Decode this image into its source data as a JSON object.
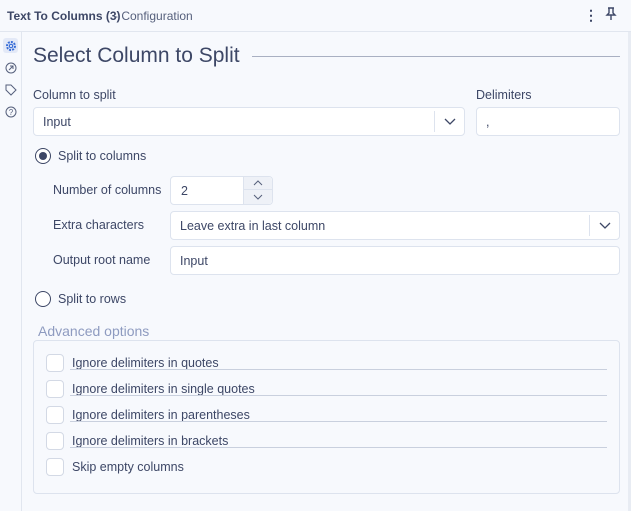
{
  "header": {
    "title": "Text To Columns (3)",
    "subtitle": "- Configuration"
  },
  "rail": {
    "icons": [
      "gear-icon",
      "output-icon",
      "tag-icon",
      "help-icon"
    ]
  },
  "main": {
    "title": "Select Column to Split",
    "column_to_split": {
      "label": "Column to split",
      "value": "Input"
    },
    "delimiters": {
      "label": "Delimiters",
      "value": ","
    },
    "split_columns": {
      "label": "Split to columns",
      "selected": true
    },
    "num_columns": {
      "label": "Number of columns",
      "value": "2"
    },
    "extra_chars": {
      "label": "Extra characters",
      "value": "Leave extra in last column"
    },
    "output_root": {
      "label": "Output root name",
      "value": "Input"
    },
    "split_rows": {
      "label": "Split to rows",
      "selected": false
    },
    "advanced": {
      "label": "Advanced options",
      "options": [
        {
          "label": "Ignore delimiters in quotes",
          "checked": false
        },
        {
          "label": "Ignore delimiters in single quotes",
          "checked": false
        },
        {
          "label": "Ignore delimiters in parentheses",
          "checked": false
        },
        {
          "label": "Ignore delimiters in brackets",
          "checked": false
        },
        {
          "label": "Skip empty columns",
          "checked": false
        }
      ]
    }
  }
}
